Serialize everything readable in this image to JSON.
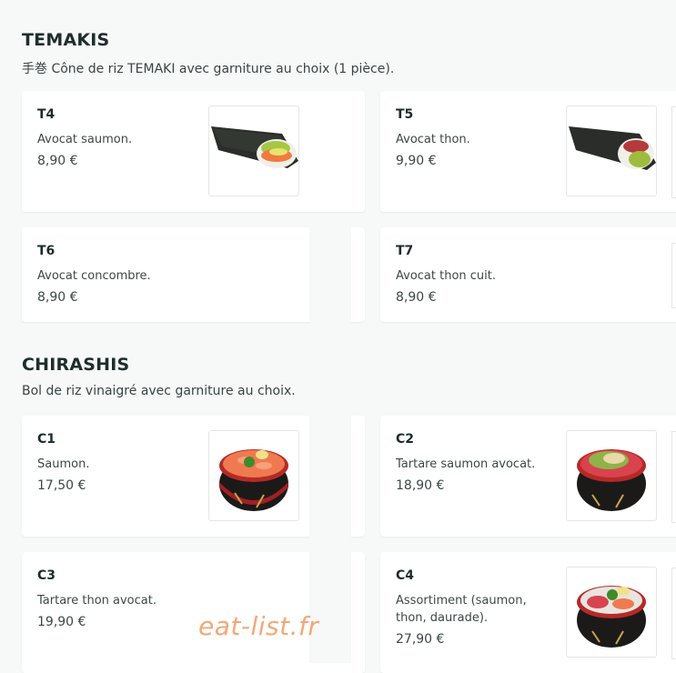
{
  "temakis": {
    "title": "TEMAKIS",
    "subtitle": "手巻 Cône de riz TEMAKI avec garniture au choix (1 pièce).",
    "items": [
      {
        "code": "T4",
        "desc": "Avocat saumon.",
        "price": "8,90 €",
        "image": "temaki-salmon-avocado-photo"
      },
      {
        "code": "T5",
        "desc": "Avocat thon.",
        "price": "9,90 €",
        "image": "temaki-tuna-avocado-photo"
      },
      {
        "code": "T6",
        "desc": "Avocat concombre.",
        "price": "8,90 €"
      },
      {
        "code": "T7",
        "desc": "Avocat thon cuit.",
        "price": "8,90 €"
      }
    ]
  },
  "chirashis": {
    "title": "CHIRASHIS",
    "subtitle": "Bol de riz vinaigré avec garniture au choix.",
    "items": [
      {
        "code": "C1",
        "desc": "Saumon.",
        "price": "17,50 €",
        "image": "chirashi-salmon-bowl-photo"
      },
      {
        "code": "C2",
        "desc": "Tartare saumon avocat.",
        "price": "18,90 €",
        "image": "chirashi-tartare-bowl-photo"
      },
      {
        "code": "C3",
        "desc": "Tartare thon avocat.",
        "price": "19,90 €"
      },
      {
        "code": "C4",
        "desc_line1": "Assortiment (saumon,",
        "desc_line2": "thon, daurade).",
        "price": "27,90 €",
        "image": "chirashi-assortment-bowl-photo"
      }
    ]
  },
  "watermark": "eat-list.fr"
}
